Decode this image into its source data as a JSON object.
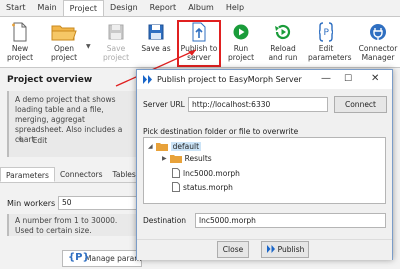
{
  "menu": {
    "tabs": [
      "Start",
      "Main",
      "Project",
      "Design",
      "Report",
      "Album",
      "Help"
    ]
  },
  "ribbon": {
    "new_project": "New project",
    "open_project": "Open project",
    "save_project": "Save project",
    "save_as": "Save as",
    "publish_to_server": "Publish to server",
    "run_project": "Run project",
    "reload_and_run": "Reload and run",
    "edit_parameters": "Edit parameters",
    "connector_manager": "Connector Manager"
  },
  "left": {
    "section_title": "Project overview",
    "description": "A demo project that shows loading table and a file, merging, aggregat spreadsheet. Also includes a chart",
    "edit_label": "Edit",
    "tabs": [
      "Parameters",
      "Connectors",
      "Tables"
    ],
    "min_workers_label": "Min workers",
    "min_workers_value": "50",
    "note": "A number from 1 to 30000. Used to certain size.",
    "manage_params": "Manage parameters"
  },
  "dialog": {
    "title": "Publish project to EasyMorph Server",
    "server_url_label": "Server URL",
    "server_url_value": "http://localhost:6330",
    "connect_label": "Connect",
    "pick_label": "Pick destination folder or file to overwrite",
    "tree": {
      "root": "default",
      "folder": "Results",
      "files": [
        "lnc5000.morph",
        "status.morph"
      ]
    },
    "destination_label": "Destination",
    "destination_value": "lnc5000.morph",
    "close_label": "Close",
    "publish_label": "Publish"
  },
  "colors": {
    "highlight": "#e02020",
    "accent": "#1a66c9",
    "folder": "#e8a23a",
    "run_green": "#1a9c3a"
  }
}
